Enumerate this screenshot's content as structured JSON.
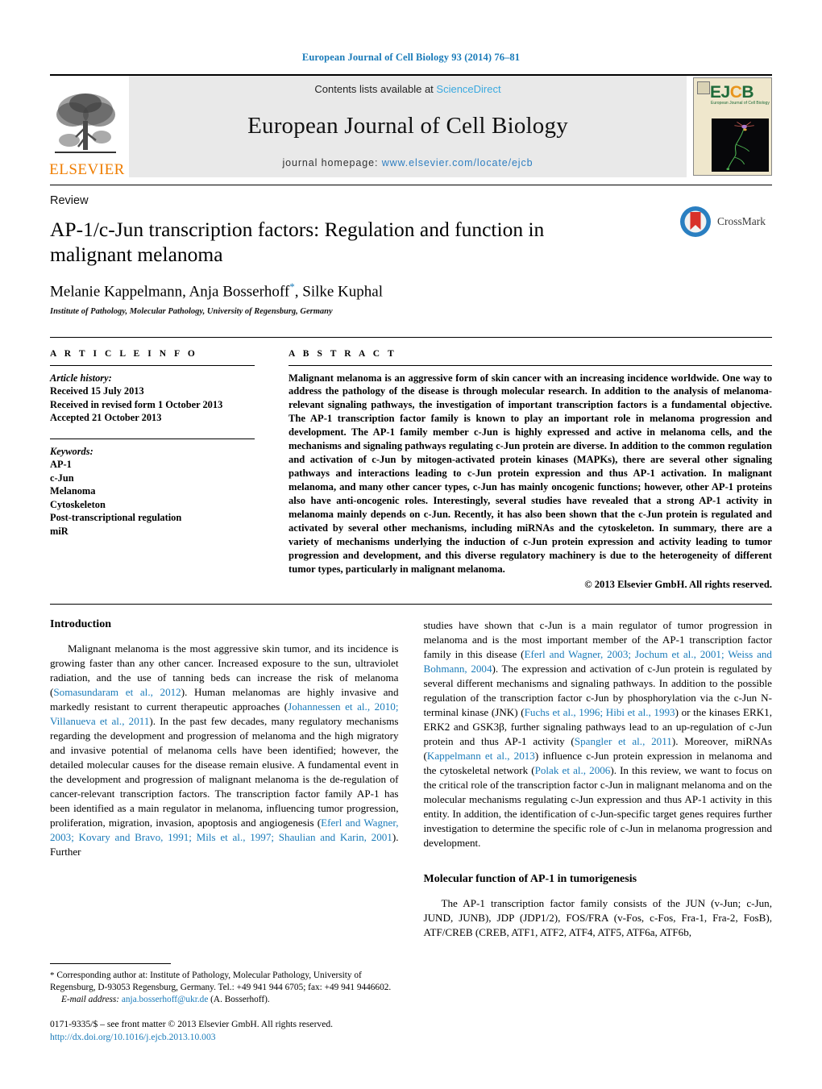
{
  "running_head": "European Journal of Cell Biology 93 (2014) 76–81",
  "masthead": {
    "elsevier_wordmark": "ELSEVIER",
    "contents_prefix": "Contents lists available at ",
    "sciencedirect": "ScienceDirect",
    "journal_title": "European Journal of Cell Biology",
    "homepage_prefix": "journal homepage: ",
    "homepage_url": "www.elsevier.com/locate/ejcb",
    "cover": {
      "acronym_e": "E",
      "acronym_j": "J",
      "acronym_c": "C",
      "acronym_b": "B",
      "subtitle": "European Journal of Cell Biology"
    },
    "colors": {
      "link": "#3aa9e0",
      "elsevier_orange": "#ef7d00",
      "cover_green": "#1f6b3a",
      "cover_orange": "#e8951c"
    }
  },
  "article": {
    "type": "Review",
    "title": "AP-1/c-Jun transcription factors: Regulation and function in malignant melanoma",
    "authors": "Melanie Kappelmann, Anja Bosserhoff",
    "authors_tail": ", Silke Kuphal",
    "corresponding_marker": "*",
    "affiliation": "Institute of Pathology, Molecular Pathology, University of Regensburg, Germany",
    "crossmark_label": "CrossMark"
  },
  "info": {
    "label": "A R T I C L E  I N F O",
    "history_head": "Article history:",
    "history": [
      "Received 15 July 2013",
      "Received in revised form 1 October 2013",
      "Accepted 21 October 2013"
    ],
    "keywords_head": "Keywords:",
    "keywords": [
      "AP-1",
      "c-Jun",
      "Melanoma",
      "Cytoskeleton",
      "Post-transcriptional regulation",
      "miR"
    ]
  },
  "abstract": {
    "label": "A B S T R A C T",
    "text": "Malignant melanoma is an aggressive form of skin cancer with an increasing incidence worldwide. One way to address the pathology of the disease is through molecular research. In addition to the analysis of melanoma-relevant signaling pathways, the investigation of important transcription factors is a fundamental objective. The AP-1 transcription factor family is known to play an important role in melanoma progression and development. The AP-1 family member c-Jun is highly expressed and active in melanoma cells, and the mechanisms and signaling pathways regulating c-Jun protein are diverse. In addition to the common regulation and activation of c-Jun by mitogen-activated protein kinases (MAPKs), there are several other signaling pathways and interactions leading to c-Jun protein expression and thus AP-1 activation. In malignant melanoma, and many other cancer types, c-Jun has mainly oncogenic functions; however, other AP-1 proteins also have anti-oncogenic roles. Interestingly, several studies have revealed that a strong AP-1 activity in melanoma mainly depends on c-Jun. Recently, it has also been shown that the c-Jun protein is regulated and activated by several other mechanisms, including miRNAs and the cytoskeleton. In summary, there are a variety of mechanisms underlying the induction of c-Jun protein expression and activity leading to tumor progression and development, and this diverse regulatory machinery is due to the heterogeneity of different tumor types, particularly in malignant melanoma.",
    "copyright": "© 2013 Elsevier GmbH. All rights reserved."
  },
  "body": {
    "left": {
      "heading": "Introduction",
      "para1_a": "Malignant melanoma is the most aggressive skin tumor, and its incidence is growing faster than any other cancer. Increased exposure to the sun, ultraviolet radiation, and the use of tanning beds can increase the risk of melanoma (",
      "cite1": "Somasundaram et al., 2012",
      "para1_b": "). Human melanomas are highly invasive and markedly resistant to current therapeutic approaches (",
      "cite2": "Johannessen et al., 2010; Villanueva et al., 2011",
      "para1_c": "). In the past few decades, many regulatory mechanisms regarding the development and progression of melanoma and the high migratory and invasive potential of melanoma cells have been identified; however, the detailed molecular causes for the disease remain elusive. A fundamental event in the development and progression of malignant melanoma is the de-regulation of cancer-relevant transcription factors. The transcription factor family AP-1 has been identified as a main regulator in melanoma, influencing tumor progression, proliferation, migration, invasion, apoptosis and angiogenesis (",
      "cite3": "Eferl and Wagner, 2003; Kovary and Bravo, 1991; Mils et al., 1997; Shaulian and Karin, 2001",
      "para1_d": "). Further"
    },
    "right": {
      "para1_a": "studies have shown that c-Jun is a main regulator of tumor progression in melanoma and is the most important member of the AP-1 transcription factor family in this disease (",
      "cite1": "Eferl and Wagner, 2003; Jochum et al., 2001; Weiss and Bohmann, 2004",
      "para1_b": "). The expression and activation of c-Jun protein is regulated by several different mechanisms and signaling pathways. In addition to the possible regulation of the transcription factor c-Jun by phosphorylation via the c-Jun N-terminal kinase (JNK) (",
      "cite2": "Fuchs et al., 1996; Hibi et al., 1993",
      "para1_c": ") or the kinases ERK1, ERK2 and GSK3β, further signaling pathways lead to an up-regulation of c-Jun protein and thus AP-1 activity (",
      "cite3": "Spangler et al., 2011",
      "para1_d": "). Moreover, miRNAs (",
      "cite4": "Kappelmann et al., 2013",
      "para1_e": ") influence c-Jun protein expression in melanoma and the cytoskeletal network (",
      "cite5": "Polak et al., 2006",
      "para1_f": "). In this review, we want to focus on the critical role of the transcription factor c-Jun in malignant melanoma and on the molecular mechanisms regulating c-Jun expression and thus AP-1 activity in this entity. In addition, the identification of c-Jun-specific target genes requires further investigation to determine the specific role of c-Jun in melanoma progression and development.",
      "heading2": "Molecular function of AP-1 in tumorigenesis",
      "para2": "The AP-1 transcription factor family consists of the JUN (v-Jun; c-Jun, JUND, JUNB), JDP (JDP1/2), FOS/FRA (v-Fos, c-Fos, Fra-1, Fra-2, FosB), ATF/CREB (CREB, ATF1, ATF2, ATF4, ATF5, ATF6a, ATF6b,"
    }
  },
  "footnotes": {
    "corresponding_star": "*",
    "corresponding_text": " Corresponding author at: Institute of Pathology, Molecular Pathology, University of Regensburg, D-93053 Regensburg, Germany. Tel.: +49 941 944 6705; fax: +49 941 9446602.",
    "email_label": "E-mail address:",
    "email": "anja.bosserhoff@ukr.de",
    "email_suffix": " (A. Bosserhoff).",
    "issn_line": "0171-9335/$ – see front matter © 2013 Elsevier GmbH. All rights reserved.",
    "doi": "http://dx.doi.org/10.1016/j.ejcb.2013.10.003"
  }
}
